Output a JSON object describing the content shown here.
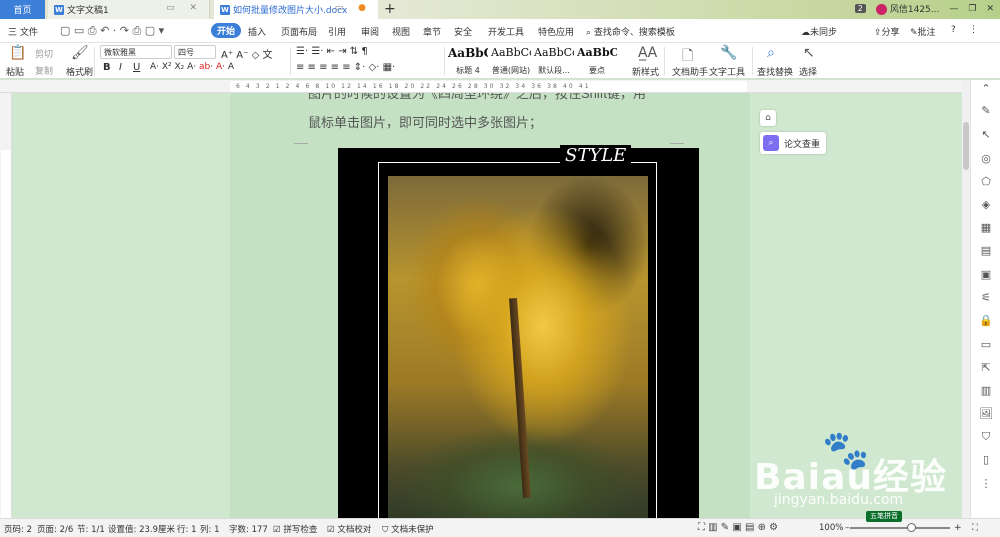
{
  "tabs": {
    "home": "首页",
    "doc1": "文字文稿1",
    "doc2": "如何批量修改图片大小.docx",
    "new": "+"
  },
  "titlebar_right": {
    "count": "2",
    "user": "风信1425...",
    "minimize": "—",
    "restore": "❐",
    "close": "✕"
  },
  "menu": {
    "file": "三 文件",
    "items": [
      "开始",
      "插入",
      "页面布局",
      "引用",
      "审阅",
      "视图",
      "章节",
      "安全",
      "开发工具",
      "特色应用"
    ],
    "search": "查找命令、搜索模板",
    "sync": "未同步",
    "share": "分享",
    "comment": "批注",
    "help": "?",
    "more": "⋮"
  },
  "ribbon": {
    "paste": "粘贴",
    "cut": "剪切",
    "copy": "复制",
    "format_painter": "格式刷",
    "font": "微软雅黑",
    "size": "四号",
    "bold": "B",
    "italic": "I",
    "underline": "U",
    "styles": [
      {
        "sample": "AaBbC",
        "name": "标题 4"
      },
      {
        "sample": "AaBbCcDd",
        "name": "普通(网站)"
      },
      {
        "sample": "AaBbCcDd",
        "name": "默认段..."
      },
      {
        "sample": "AaBbCcDd",
        "name": "要点"
      }
    ],
    "new_style": "新样式",
    "writing_assistant": "文档助手",
    "text_tools": "文字工具",
    "find_replace": "查找替换",
    "select": "选择"
  },
  "ruler": {
    "marks": "6 4 3 2 1 2 4 6 8 10 12 14 16 18 20 22 24 26 28 30 32 34 36 38 40 41"
  },
  "document": {
    "line_cut": "图片的时候的设置为《四周型环绕》之后，按住Shift键，用",
    "line_main": "鼠标单击图片，即可同时选中多张图片；",
    "image_title": "STYLE"
  },
  "side_float": {
    "up": "⌂",
    "plagiarism_check": "论文查重"
  },
  "watermark": {
    "brand": "Baiau经验",
    "url": "jingyan.baidu.com"
  },
  "status": {
    "page_no": "页码: 2",
    "pages": "页面: 2/6",
    "section": "节: 1/1",
    "setting": "设置值: 23.9厘米",
    "row": "行: 1",
    "col": "列: 1",
    "wordcount": "字数: 177",
    "spellcheck": "拼写检查",
    "proof": "文档校对",
    "protect": "文档未保护",
    "zoom": "100%",
    "ime": "五笔拼音"
  },
  "colors": {
    "accent": "#3c7fd8",
    "canvas": "#cfe8cf",
    "page": "#c4e2c3"
  }
}
